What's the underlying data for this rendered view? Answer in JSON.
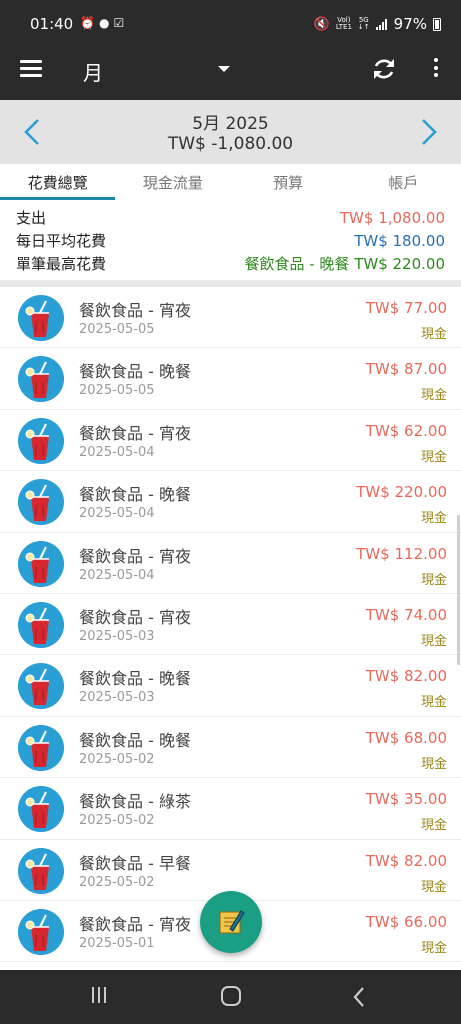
{
  "status_bar": {
    "time": "01:40",
    "network_top": "Vol)",
    "network_bottom": "LTE1",
    "gen_top": "5G",
    "gen_bottom": "↓↑",
    "battery": "97%"
  },
  "app_bar": {
    "period": "月",
    "icons": [
      "menu-icon",
      "dropdown-caret-icon",
      "sync-icon",
      "more-vert-icon"
    ]
  },
  "month_header": {
    "title": "5月  2025",
    "total": "TW$ -1,080.00"
  },
  "tabs": [
    {
      "label": "花費總覽",
      "active": true
    },
    {
      "label": "現金流量",
      "active": false
    },
    {
      "label": "預算",
      "active": false
    },
    {
      "label": "帳戶",
      "active": false
    }
  ],
  "summary": {
    "expense_label": "支出",
    "expense_value": "TW$ 1,080.00",
    "daily_avg_label": "每日平均花費",
    "daily_avg_value": "TW$ 180.00",
    "max_label": "單筆最高花費",
    "max_value": "餐飲食品 - 晚餐 TW$ 220.00"
  },
  "transactions": [
    {
      "title": "餐飲食品 - 宵夜",
      "date": "2025-05-05",
      "amount": "TW$ 77.00",
      "account": "現金"
    },
    {
      "title": "餐飲食品 - 晚餐",
      "date": "2025-05-05",
      "amount": "TW$ 87.00",
      "account": "現金"
    },
    {
      "title": "餐飲食品 - 宵夜",
      "date": "2025-05-04",
      "amount": "TW$ 62.00",
      "account": "現金"
    },
    {
      "title": "餐飲食品 - 晚餐",
      "date": "2025-05-04",
      "amount": "TW$ 220.00",
      "account": "現金"
    },
    {
      "title": "餐飲食品 - 宵夜",
      "date": "2025-05-04",
      "amount": "TW$ 112.00",
      "account": "現金"
    },
    {
      "title": "餐飲食品 - 宵夜",
      "date": "2025-05-03",
      "amount": "TW$ 74.00",
      "account": "現金"
    },
    {
      "title": "餐飲食品 - 晚餐",
      "date": "2025-05-03",
      "amount": "TW$ 82.00",
      "account": "現金"
    },
    {
      "title": "餐飲食品 - 晚餐",
      "date": "2025-05-02",
      "amount": "TW$ 68.00",
      "account": "現金"
    },
    {
      "title": "餐飲食品 - 綠茶",
      "date": "2025-05-02",
      "amount": "TW$ 35.00",
      "account": "現金"
    },
    {
      "title": "餐飲食品 - 早餐",
      "date": "2025-05-02",
      "amount": "TW$ 82.00",
      "account": "現金"
    },
    {
      "title": "餐飲食品 - 宵夜",
      "date": "2025-05-01",
      "amount": "TW$ 66.00",
      "account": "現金"
    }
  ],
  "colors": {
    "bar_bg": "#2b2b2b",
    "accent": "#1e88a8",
    "expense_red": "#e8695a",
    "avg_blue": "#2a6fb0",
    "max_green": "#2e8b1e",
    "account_olive": "#9a8a1a",
    "category_icon_bg": "#2a9fd6",
    "fab": "#1a9e84"
  }
}
